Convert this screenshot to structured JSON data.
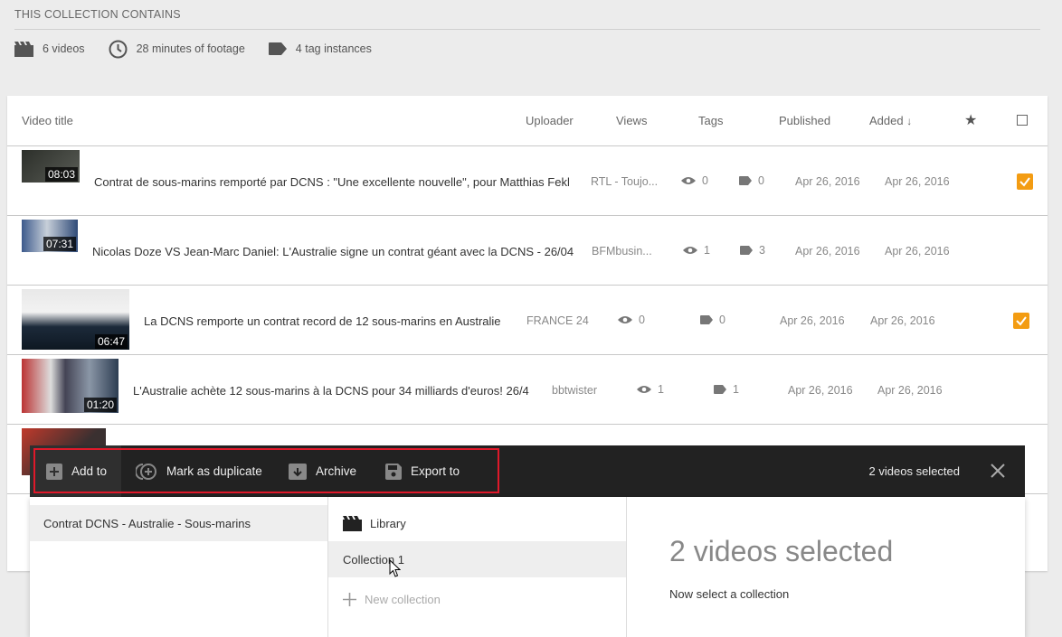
{
  "summary": {
    "title": "THIS COLLECTION CONTAINS",
    "videos": "6 videos",
    "footage": "28 minutes of footage",
    "tags": "4 tag instances"
  },
  "table": {
    "headers": {
      "title": "Video title",
      "uploader": "Uploader",
      "views": "Views",
      "tags": "Tags",
      "published": "Published",
      "added": "Added"
    },
    "rows": [
      {
        "duration": "08:03",
        "title": "Contrat de sous-marins remporté par DCNS : \"Une excellente nouvelle\", pour Matthias Fekl",
        "uploader": "RTL - Toujo...",
        "views": "0",
        "tags": "0",
        "published": "Apr 26, 2016",
        "added": "Apr 26, 2016",
        "checked": true
      },
      {
        "duration": "07:31",
        "title": "Nicolas Doze VS Jean-Marc Daniel: L'Australie signe un contrat géant avec la DCNS - 26/04",
        "uploader": "BFMbusin...",
        "views": "1",
        "tags": "3",
        "published": "Apr 26, 2016",
        "added": "Apr 26, 2016",
        "checked": false
      },
      {
        "duration": "06:47",
        "title": "La DCNS remporte un contrat record de 12 sous-marins en Australie",
        "uploader": "FRANCE 24",
        "views": "0",
        "tags": "0",
        "published": "Apr 26, 2016",
        "added": "Apr 26, 2016",
        "checked": true
      },
      {
        "duration": "01:20",
        "title": "L'Australie achète 12 sous-marins à la DCNS pour 34 milliards d'euros! 26/4",
        "uploader": "bbtwister",
        "views": "1",
        "tags": "1",
        "published": "Apr 26, 2016",
        "added": "Apr 26, 2016",
        "checked": false
      }
    ]
  },
  "toolbar": {
    "add": "Add to",
    "duplicate": "Mark as duplicate",
    "archive": "Archive",
    "export": "Export to",
    "selected": "2 videos selected"
  },
  "panel": {
    "collection": "Contrat DCNS - Australie - Sous-marins",
    "library": "Library",
    "collection1": "Collection 1",
    "new_collection": "New collection",
    "headline": "2 videos selected",
    "instruction": "Now select a collection"
  },
  "colors": {
    "accent": "#f39c12",
    "toolbar": "#222222",
    "highlight": "#e0192a"
  }
}
